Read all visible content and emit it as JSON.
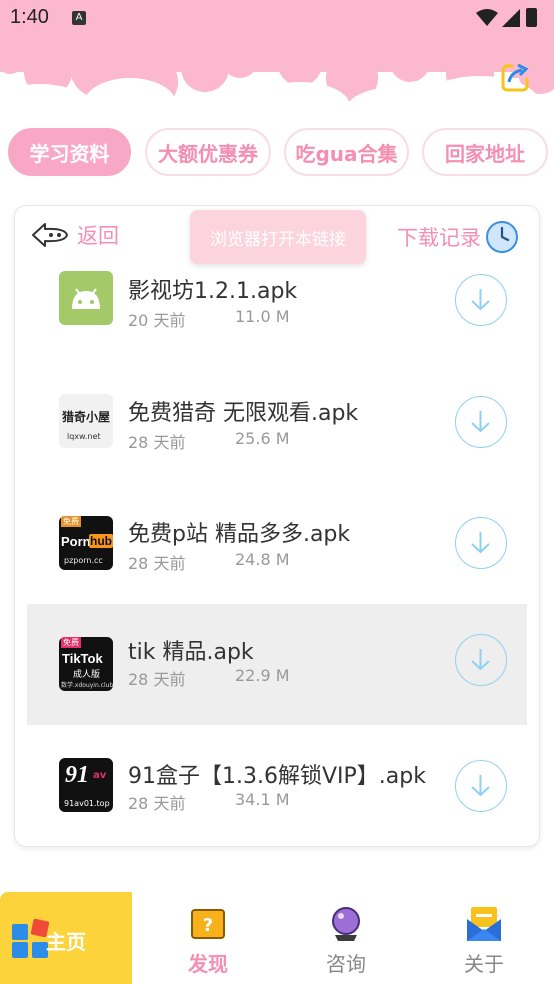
{
  "status_bar": {
    "time": "1:40",
    "notification_glyph": "A"
  },
  "tabs": [
    {
      "label": "学习资料",
      "active": true
    },
    {
      "label": "大额优惠券",
      "active": false
    },
    {
      "label": "吃gua合集",
      "active": false
    },
    {
      "label": "回家地址",
      "active": false
    }
  ],
  "card": {
    "back_label": "返回",
    "toast": "浏览器打开本链接",
    "history_label": "下载记录"
  },
  "files": [
    {
      "name": "影视坊1.2.1.apk",
      "age": "20 天前",
      "size": "11.0 M",
      "icon": "android-icon"
    },
    {
      "name": "免费猎奇 无限观看.apk",
      "age": "28 天前",
      "size": "25.6 M",
      "icon": "app-icon-lieqi",
      "icon_text": "猎奇小屋",
      "icon_sub": "lqxw.net"
    },
    {
      "name": "免费p站 精品多多.apk",
      "age": "28 天前",
      "size": "24.8 M",
      "icon": "app-icon-ph",
      "icon_text": "Porn",
      "icon_text2": "hub",
      "icon_sub": "pzporn.cc",
      "icon_tag": "免费"
    },
    {
      "name": "tik 精品.apk",
      "age": "28 天前",
      "size": "22.9 M",
      "icon": "app-icon-tiktok",
      "icon_text": "TikTok",
      "icon_text2": "成人版",
      "icon_sub": "数学.xdouyin.club",
      "icon_tag": "免费"
    },
    {
      "name": "91盒子【1.3.6解锁VIP】.apk",
      "age": "28 天前",
      "size": "34.1 M",
      "icon": "app-icon-91",
      "icon_text": "91",
      "icon_text2": "av",
      "icon_sub": "91av01.top"
    }
  ],
  "bottom_nav": [
    {
      "label": "主页",
      "icon": "home-grid-icon",
      "active": true
    },
    {
      "label": "发现",
      "icon": "question-box-icon",
      "active": false
    },
    {
      "label": "咨询",
      "icon": "crystal-ball-icon",
      "active": false
    },
    {
      "label": "关于",
      "icon": "mail-icon",
      "active": false
    }
  ],
  "colors": {
    "pink": "#f8a8c4",
    "pink_text": "#f48fb1",
    "blue_outline": "#8fd1f2",
    "yellow": "#fcd33b"
  }
}
